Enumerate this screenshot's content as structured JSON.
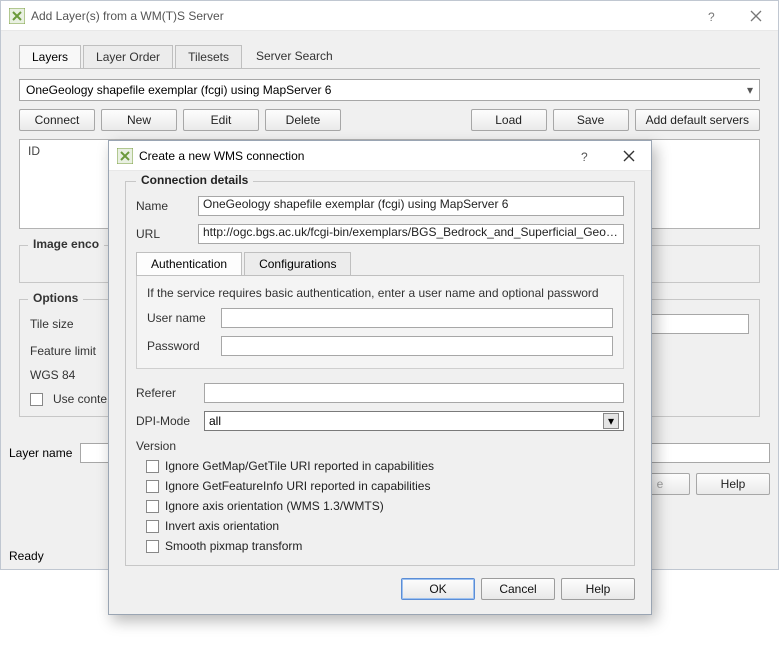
{
  "main": {
    "title": "Add Layer(s) from a WM(T)S Server",
    "tabs": {
      "layers": "Layers",
      "layer_order": "Layer Order",
      "tilesets": "Tilesets",
      "server_search": "Server Search"
    },
    "server_value": "OneGeology shapefile exemplar (fcgi) using MapServer 6",
    "buttons": {
      "connect": "Connect",
      "new": "New",
      "edit": "Edit",
      "delete": "Delete",
      "load": "Load",
      "save": "Save",
      "add_default": "Add default servers"
    },
    "id_header": "ID",
    "group_image": "Image enco",
    "group_options": {
      "title": "Options",
      "tile_size": "Tile size",
      "feature_limit": "Feature limit",
      "wgs84": "WGS 84",
      "use_context": "Use conte"
    },
    "layer_name_label": "Layer name",
    "bottom_buttons": {
      "e_button": "e",
      "help": "Help"
    },
    "status": "Ready"
  },
  "modal": {
    "title": "Create a new WMS connection",
    "group_title": "Connection details",
    "name_label": "Name",
    "name_value": "OneGeology shapefile exemplar (fcgi) using MapServer 6",
    "url_label": "URL",
    "url_value": "http://ogc.bgs.ac.uk/fcgi-bin/exemplars/BGS_Bedrock_and_Superficial_Geology/wms?",
    "auth_tab": "Authentication",
    "conf_tab": "Configurations",
    "auth_hint": "If the service requires basic authentication, enter a user name and optional password",
    "user_label": "User name",
    "pass_label": "Password",
    "referer_label": "Referer",
    "dpi_label": "DPI-Mode",
    "dpi_value": "all",
    "version_label": "Version",
    "version_opts": {
      "ignore_getmap": "Ignore GetMap/GetTile URI reported in capabilities",
      "ignore_getfeat": "Ignore GetFeatureInfo URI reported in capabilities",
      "ignore_axis": "Ignore axis orientation (WMS 1.3/WMTS)",
      "invert_axis": "Invert axis orientation",
      "smooth": "Smooth pixmap transform"
    },
    "ok": "OK",
    "cancel": "Cancel",
    "help": "Help"
  }
}
